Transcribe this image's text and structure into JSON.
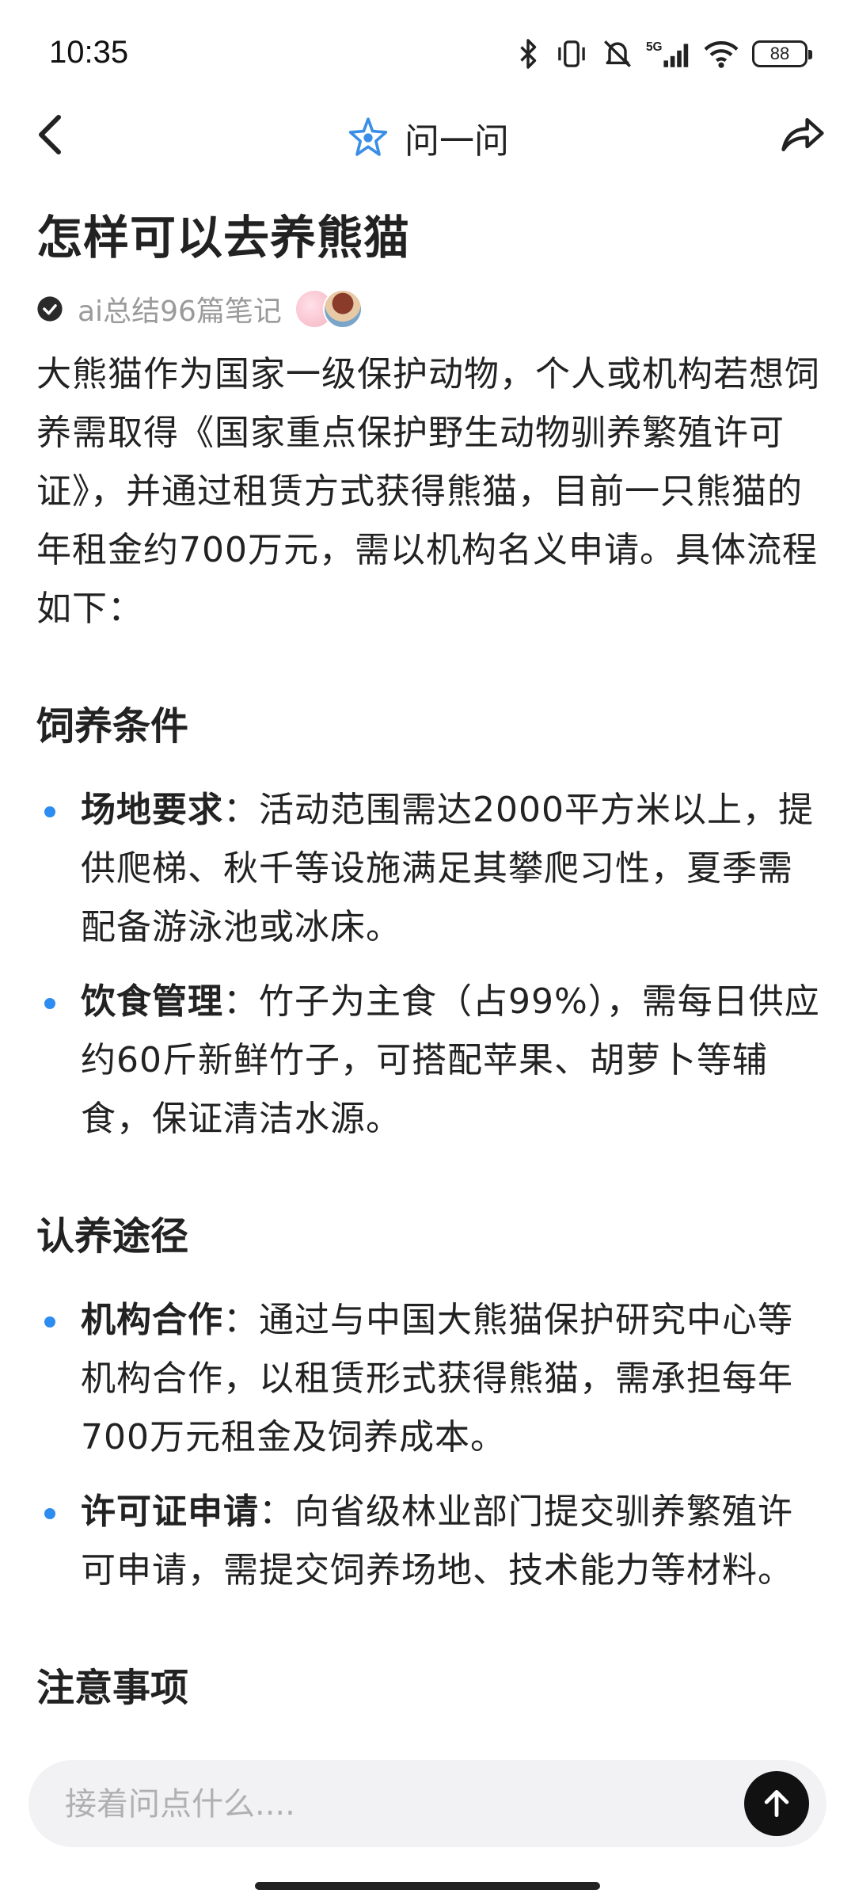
{
  "status": {
    "time": "10:35",
    "battery": "88"
  },
  "header": {
    "title": "问一问"
  },
  "question": {
    "title": "怎样可以去养熊猫",
    "meta": "ai总结96篇笔记"
  },
  "answer": {
    "intro": "大熊猫作为国家一级保护动物，个人或机构若想饲养需取得《国家重点保护野生动物驯养繁殖许可证》，并通过租赁方式获得熊猫，目前一只熊猫的年租金约700万元，需以机构名义申请。具体流程如下：",
    "sections": [
      {
        "heading": "饲养条件",
        "items": [
          {
            "label": "场地要求",
            "sep": "：",
            "text": "活动范围需达2000平方米以上，提供爬梯、秋千等设施满足其攀爬习性，夏季需配备游泳池或冰床。"
          },
          {
            "label": "饮食管理",
            "sep": "：",
            "text": "竹子为主食（占99%），需每日供应约60斤新鲜竹子，可搭配苹果、胡萝卜等辅食，保证清洁水源。"
          }
        ]
      },
      {
        "heading": "认养途径",
        "items": [
          {
            "label": "机构合作",
            "sep": "：",
            "text": "通过与中国大熊猫保护研究中心等机构合作，以租赁形式获得熊猫，需承担每年700万元租金及饲养成本。"
          },
          {
            "label": "许可证申请",
            "sep": "：",
            "text": "向省级林业部门提交驯养繁殖许可申请，需提交饲养场地、技术能力等材料。"
          }
        ]
      },
      {
        "heading": "注意事项",
        "items": []
      }
    ]
  },
  "composer": {
    "placeholder": "接着问点什么...."
  },
  "colors": {
    "bullet": "#2d8cf0",
    "accent": "#3a8ee6",
    "send_button": "#111111"
  }
}
